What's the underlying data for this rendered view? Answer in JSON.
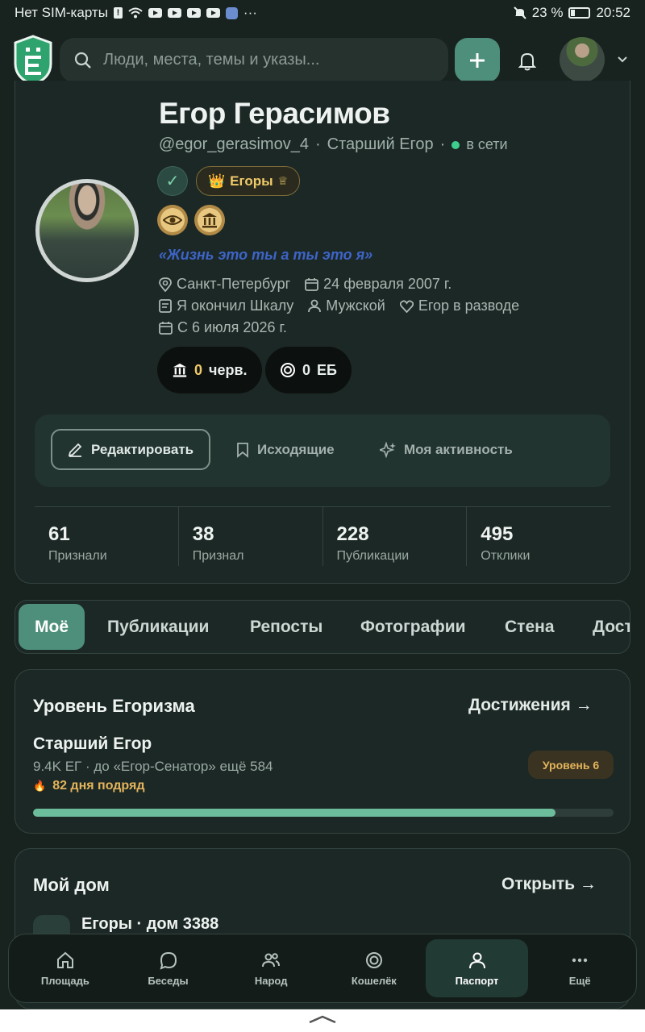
{
  "status_bar": {
    "carrier": "Нет SIM-карты",
    "battery": "23 %",
    "time": "20:52"
  },
  "header": {
    "search_placeholder": "Люди, места, темы и указы..."
  },
  "profile": {
    "name": "Егор Герасимов",
    "handle": "@egor_gerasimov_4",
    "rank": "Старший Егор",
    "status": "в сети",
    "group_badge": "Егоры",
    "quote": "«Жизнь это ты а ты это я»",
    "city": "Санкт-Петербург",
    "birthday": "24 февраля 2007 г.",
    "education": "Я окончил Шкалу",
    "gender": "Мужской",
    "relationship": "Егор в разводе",
    "since": "С 6 июля 2026 г.",
    "chervontsy_value": "0",
    "chervontsy_unit": "черв.",
    "eb_value": "0",
    "eb_unit": "ЕБ"
  },
  "actions": {
    "edit": "Редактировать",
    "outgoing": "Исходящие",
    "activity": "Моя активность"
  },
  "stats": [
    {
      "value": "61",
      "label": "Признали"
    },
    {
      "value": "38",
      "label": "Признал"
    },
    {
      "value": "228",
      "label": "Публикации"
    },
    {
      "value": "495",
      "label": "Отклики"
    }
  ],
  "tabs": [
    "Моё",
    "Публикации",
    "Репосты",
    "Фотографии",
    "Стена",
    "Дост"
  ],
  "level": {
    "title": "Уровень Егоризма",
    "link": "Достижения →",
    "rank": "Старший Егор",
    "progress_text": "9.4K ЕГ · до «Егор-Сенатор» ещё 584",
    "streak": "82 дня подряд",
    "badge": "Уровень 6",
    "progress": 0.9
  },
  "home": {
    "title": "Мой дом",
    "link": "Открыть →",
    "house": "Егоры · дом 3388"
  },
  "bottom_nav": [
    "Площадь",
    "Беседы",
    "Народ",
    "Кошелёк",
    "Паспорт",
    "Ещё"
  ],
  "colors": {
    "accent": "#4d8f7a",
    "background": "#18221f",
    "gold": "#f0cb6a",
    "online": "#3ecf8e",
    "quote": "#3d64c7"
  }
}
